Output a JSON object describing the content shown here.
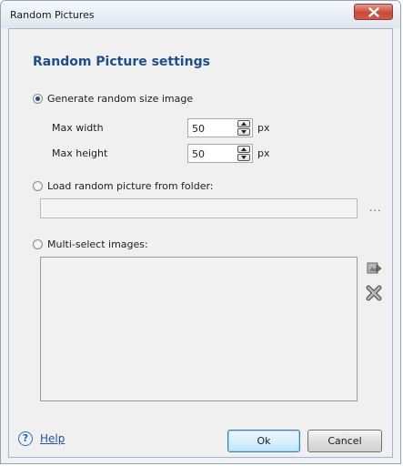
{
  "window": {
    "title": "Random Pictures"
  },
  "settings": {
    "heading": "Random Picture settings",
    "option_generate": {
      "label": "Generate random size image",
      "selected": true
    },
    "max_width": {
      "label": "Max width",
      "value": "50",
      "unit": "px"
    },
    "max_height": {
      "label": "Max height",
      "value": "50",
      "unit": "px"
    },
    "option_folder": {
      "label": "Load random picture from folder:",
      "selected": false,
      "path": "",
      "browse_label": "..."
    },
    "option_multi": {
      "label": "Multi-select images:",
      "selected": false,
      "items": []
    }
  },
  "footer": {
    "help_label": "Help",
    "ok_label": "Ok",
    "cancel_label": "Cancel"
  },
  "icons": {
    "close": "close-icon",
    "help": "help-icon",
    "add_image": "add-image-icon",
    "remove_image": "remove-image-icon"
  }
}
